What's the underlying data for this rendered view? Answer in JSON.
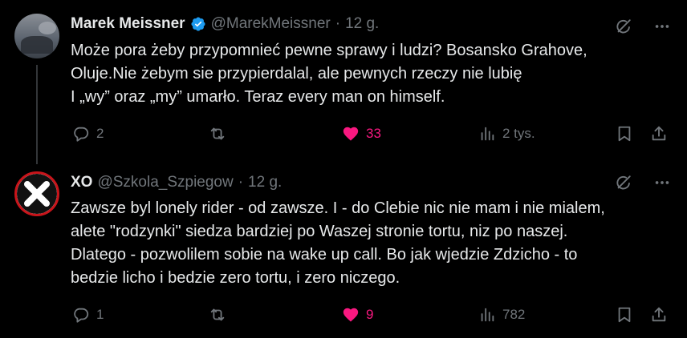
{
  "tweets": [
    {
      "name": "Marek Meissner",
      "handle": "@MarekMeissner",
      "dot": "·",
      "time": "12 g.",
      "verified": true,
      "text": "Może pora żeby przypomnieć pewne sprawy i ludzi? Bosansko Grahove,\nOluje.Nie żebym sie przypierdalal, ale pewnych rzeczy nie lubię\nI „wy” oraz „my” umarło. Teraz every man on himself.",
      "replies": "2",
      "reposts": "",
      "likes": "33",
      "views": "2 tys."
    },
    {
      "name": "XO",
      "handle": "@Szkola_Szpiegow",
      "dot": "·",
      "time": "12 g.",
      "verified": false,
      "text": "Zawsze byl lonely rider - od zawsze. I - do Clebie nic nie mam i nie mialem,\nalete \"rodzynki\" siedza bardziej po Waszej stronie tortu, niz po naszej.\nDlatego - pozwolilem sobie na wake up call. Bo jak wjedzie Zdzicho - to\nbedzie licho i bedzie zero tortu, i zero niczego.",
      "replies": "1",
      "reposts": "",
      "likes": "9",
      "views": "782"
    }
  ],
  "colors": {
    "background": "#000000",
    "text": "#e7e9ea",
    "muted": "#71767b",
    "like": "#f91880",
    "verified": "#1d9bf0"
  },
  "icons": [
    "grok-icon",
    "more-icon",
    "reply-icon",
    "repost-icon",
    "heart-icon",
    "views-icon",
    "bookmark-icon",
    "share-icon",
    "verified-badge-icon"
  ]
}
